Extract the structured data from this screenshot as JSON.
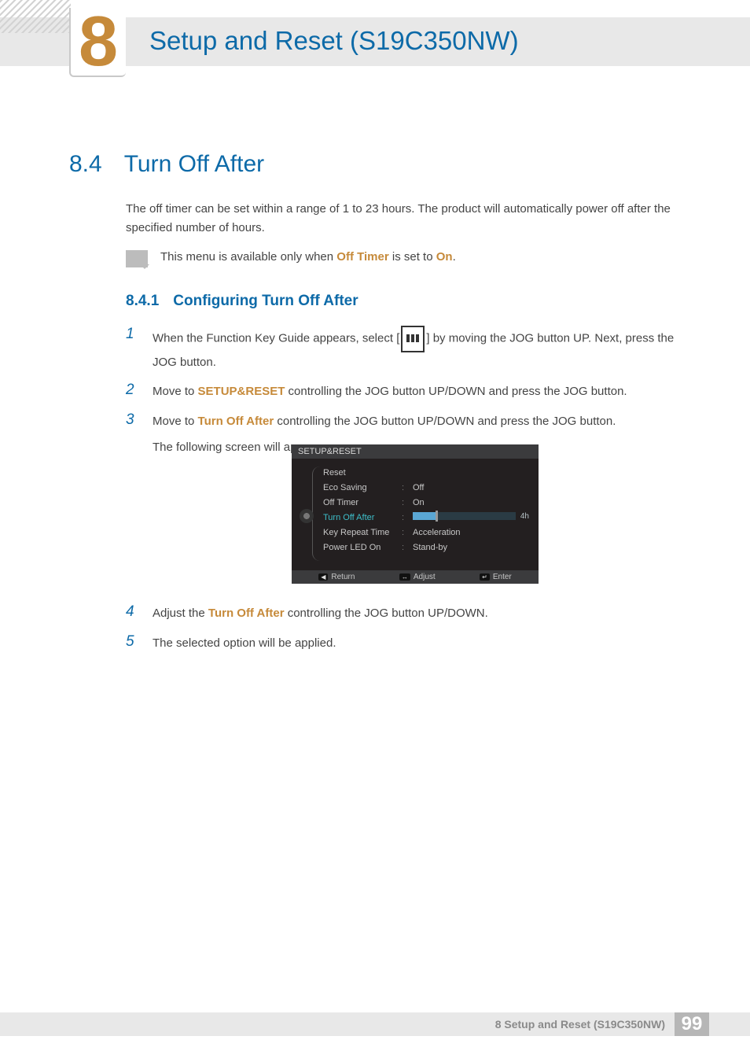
{
  "chapter": {
    "number": "8",
    "title": "Setup and Reset (S19C350NW)"
  },
  "section": {
    "number": "8.4",
    "title": "Turn Off After",
    "intro": "The off timer can be set within a range of 1 to 23 hours. The product will automatically power off after the specified number of hours."
  },
  "note": {
    "prefix": "This menu is available only when ",
    "bold1": "Off Timer",
    "mid": " is set to ",
    "bold2": "On",
    "suffix": "."
  },
  "subsection": {
    "number": "8.4.1",
    "title": "Configuring Turn Off After"
  },
  "steps": {
    "s1a": "When the Function Key Guide appears, select ",
    "s1b": " by moving the JOG button UP. Next, press the JOG button.",
    "s2a": "Move to ",
    "s2bold": "SETUP&RESET",
    "s2b": " controlling the JOG button UP/DOWN and press the JOG button.",
    "s3a": "Move to ",
    "s3bold": "Turn Off After",
    "s3b": " controlling the JOG button UP/DOWN and press the JOG button.",
    "s3c": "The following screen will appear.",
    "s4a": "Adjust the ",
    "s4bold": "Turn Off After",
    "s4b": " controlling the JOG button UP/DOWN.",
    "s5": "The selected option will be applied."
  },
  "osd": {
    "header": "SETUP&RESET",
    "rows": {
      "reset": "Reset",
      "eco": "Eco Saving",
      "eco_val": "Off",
      "offtimer": "Off Timer",
      "offtimer_val": "On",
      "turnoff": "Turn Off After",
      "turnoff_val": "4h",
      "keyrepeat": "Key Repeat Time",
      "keyrepeat_val": "Acceleration",
      "powerled": "Power LED On",
      "powerled_val": "Stand-by"
    },
    "footer": {
      "return": "Return",
      "adjust": "Adjust",
      "enter": "Enter"
    }
  },
  "footer": {
    "text": "8 Setup and Reset (S19C350NW)",
    "page": "99"
  }
}
